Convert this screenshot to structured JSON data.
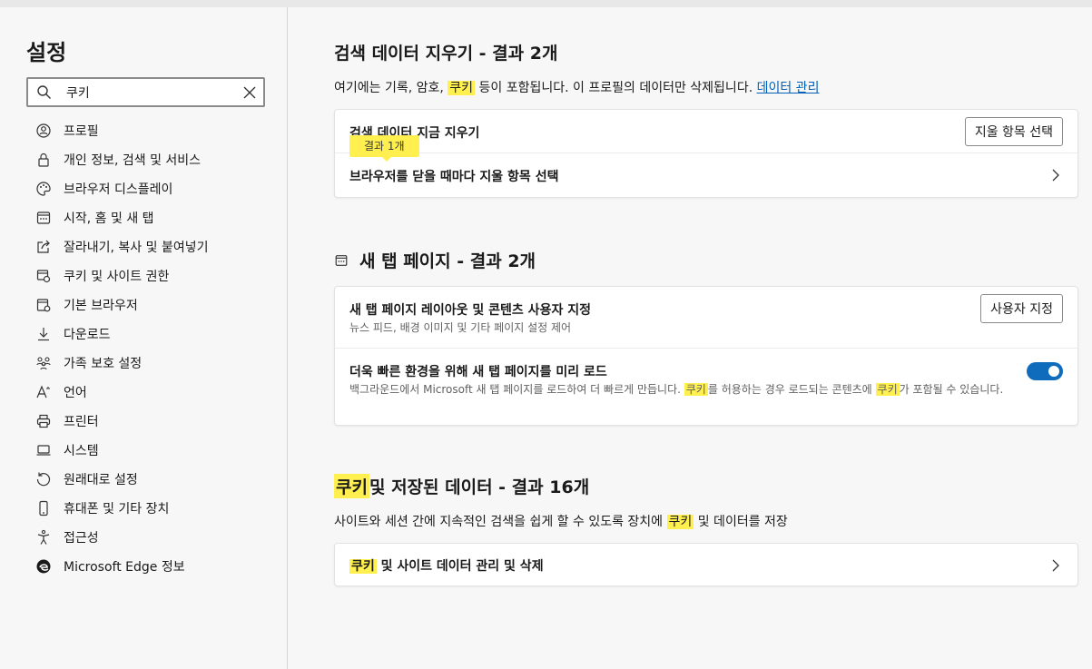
{
  "sidebar": {
    "title": "설정",
    "search": {
      "value": "쿠키",
      "placeholder": ""
    },
    "items": [
      {
        "label": "프로필",
        "icon": "profile-icon"
      },
      {
        "label": "개인 정보, 검색 및 서비스",
        "icon": "lock-icon"
      },
      {
        "label": "브라우저 디스플레이",
        "icon": "palette-icon"
      },
      {
        "label": "시작, 홈 및 새 탭",
        "icon": "home-icon"
      },
      {
        "label": "잘라내기, 복사 및 붙여넣기",
        "icon": "share-icon"
      },
      {
        "label": "쿠키 및 사이트 권한",
        "icon": "cookie-icon"
      },
      {
        "label": "기본 브라우저",
        "icon": "browser-icon"
      },
      {
        "label": "다운로드",
        "icon": "download-icon"
      },
      {
        "label": "가족 보호 설정",
        "icon": "family-icon"
      },
      {
        "label": "언어",
        "icon": "language-icon"
      },
      {
        "label": "프린터",
        "icon": "printer-icon"
      },
      {
        "label": "시스템",
        "icon": "system-icon"
      },
      {
        "label": "원래대로 설정",
        "icon": "reset-icon"
      },
      {
        "label": "휴대폰 및 기타 장치",
        "icon": "phone-icon"
      },
      {
        "label": "접근성",
        "icon": "accessibility-icon"
      },
      {
        "label": "Microsoft Edge 정보",
        "icon": "edge-icon"
      }
    ]
  },
  "sections": {
    "clear": {
      "title": "검색 데이터 지우기 - 결과 2개",
      "desc_pre": "여기에는 기록, 암호, ",
      "desc_hl": "쿠키",
      "desc_post": " 등이 포함됩니다. 이 프로필의 데이터만 삭제됩니다. ",
      "desc_link": "데이터 관리",
      "row1_title": "검색 데이터 지금 지우기",
      "row1_button": "지울 항목 선택",
      "tooltip": "결과 1개",
      "row2_title": "브라우저를 닫을 때마다 지울 항목 선택"
    },
    "newtab": {
      "title": "새 탭 페이지 - 결과 2개",
      "row1_title": "새 탭 페이지 레이아웃 및 콘텐츠 사용자 지정",
      "row1_sub": "뉴스 피드, 배경 이미지 및 기타 페이지 설정 제어",
      "row1_button": "사용자 지정",
      "row2_title": "더욱 빠른 환경을 위해 새 탭 페이지를 미리 로드",
      "row2_sub_a": "백그라운드에서 Microsoft 새 탭 페이지를 로드하여 더 빠르게 만듭니다. ",
      "row2_sub_hl1": "쿠키",
      "row2_sub_b": "를 허용하는 경우 로드되는 콘텐츠에 ",
      "row2_sub_hl2": "쿠키",
      "row2_sub_c": "가 포함될 수 있습니다.",
      "toggle_on": true
    },
    "cookies": {
      "title_hl": "쿠키",
      "title_rest": " 및 저장된 데이터 - 결과 16개",
      "desc_pre": "사이트와 세션 간에 지속적인 검색을 쉽게 할 수 있도록 장치에 ",
      "desc_hl": "쿠키",
      "desc_post": " 및 데이터를 저장",
      "row1_hl": "쿠키",
      "row1_rest": " 및 사이트 데이터 관리 및 삭제"
    }
  },
  "colors": {
    "highlight": "#fff04f",
    "accent": "#0f6cbd",
    "link": "#005fb8"
  }
}
